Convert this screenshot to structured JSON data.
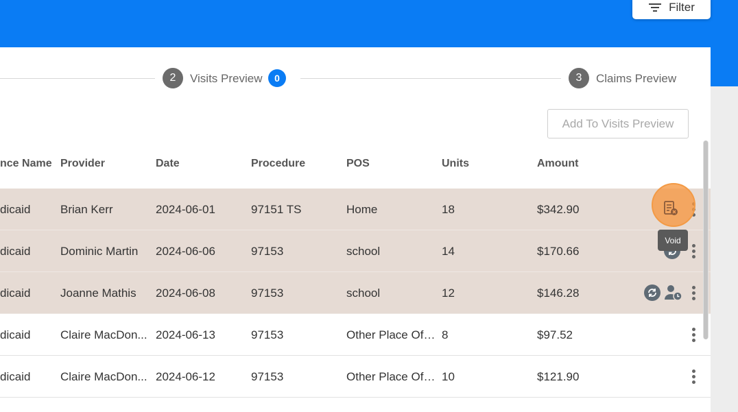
{
  "header": {
    "filter_label": "Filter",
    "icons": {
      "filter": "filter-list-icon"
    },
    "colors": {
      "primary": "#0a7cf4"
    }
  },
  "stepper": {
    "steps": [
      {
        "number": "2",
        "label": "Visits Preview",
        "badge": "0"
      },
      {
        "number": "3",
        "label": "Claims Preview"
      }
    ]
  },
  "toolbar": {
    "add_to_visits_label": "Add To Visits Preview"
  },
  "table": {
    "columns": [
      "nce Name",
      "Provider",
      "Date",
      "Procedure",
      "POS",
      "Units",
      "Amount"
    ],
    "rows": [
      {
        "insurance": "dicaid",
        "provider": "Brian Kerr",
        "date": "2024-06-01",
        "procedure": "97151 TS",
        "pos": "Home",
        "units": "18",
        "amount": "$342.90",
        "highlighted": true
      },
      {
        "insurance": "dicaid",
        "provider": "Dominic Martin",
        "date": "2024-06-06",
        "procedure": "97153",
        "pos": "school",
        "units": "14",
        "amount": "$170.66",
        "highlighted": true
      },
      {
        "insurance": "dicaid",
        "provider": "Joanne Mathis",
        "date": "2024-06-08",
        "procedure": "97153",
        "pos": "school",
        "units": "12",
        "amount": "$146.28",
        "highlighted": true
      },
      {
        "insurance": "dicaid",
        "provider": "Claire MacDon...",
        "date": "2024-06-13",
        "procedure": "97153",
        "pos": "Other Place Of ...",
        "units": "8",
        "amount": "$97.52",
        "highlighted": false
      },
      {
        "insurance": "dicaid",
        "provider": "Claire MacDon...",
        "date": "2024-06-12",
        "procedure": "97153",
        "pos": "Other Place Of ...",
        "units": "10",
        "amount": "$121.90",
        "highlighted": false
      }
    ],
    "row_icons": {
      "void": "void-document-icon",
      "sync": "sync-circle-icon",
      "user_clock": "user-clock-icon",
      "more": "more-vertical-icon"
    },
    "colors": {
      "highlight_row": "#e6dbd4",
      "void_highlight": "#f6a05a"
    }
  },
  "tooltip": {
    "void_label": "Void"
  }
}
